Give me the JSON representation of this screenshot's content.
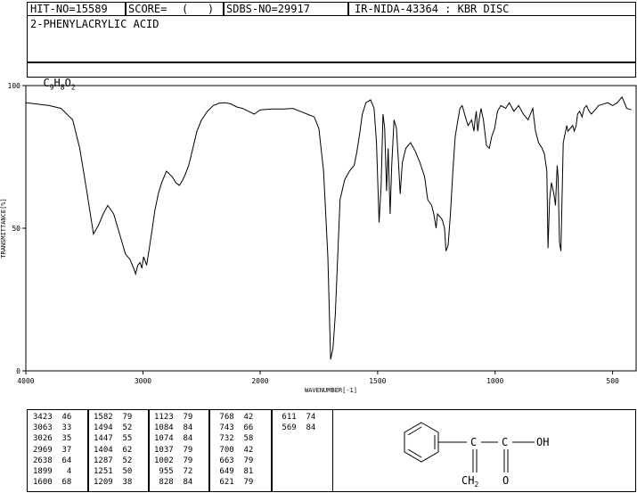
{
  "header": {
    "hit_no": "HIT-NO=15589",
    "score_label": "SCORE=",
    "score_value": "(   )",
    "sdbs_no": "SDBS-NO=29917",
    "ir_info": "IR-NIDA-43364 : KBR DISC"
  },
  "compound": {
    "name": "2-PHENYLACRYLIC ACID",
    "formula_c": "C",
    "formula_c_sub": "9",
    "formula_h": "H",
    "formula_h_sub": "8",
    "formula_o": "O",
    "formula_o_sub": "2"
  },
  "chart_data": {
    "type": "line",
    "xlabel": "WAVENUMBER[-1]",
    "ylabel": "TRANSMITTANCE[%]",
    "xlim": [
      4000,
      400
    ],
    "ylim": [
      0,
      100
    ],
    "x_ticks": [
      {
        "value": 4000,
        "label": "4000"
      },
      {
        "value": 3000,
        "label": "3000"
      },
      {
        "value": 2000,
        "label": "2000"
      },
      {
        "value": 1500,
        "label": "1500"
      },
      {
        "value": 1000,
        "label": "1000"
      },
      {
        "value": 500,
        "label": "500"
      }
    ],
    "y_ticks": [
      {
        "value": 100,
        "label": "100"
      },
      {
        "value": 50,
        "label": "50"
      },
      {
        "value": 0,
        "label": "0"
      }
    ],
    "x": [
      4000,
      3900,
      3800,
      3700,
      3600,
      3540,
      3480,
      3423,
      3380,
      3340,
      3300,
      3250,
      3200,
      3150,
      3110,
      3080,
      3063,
      3045,
      3026,
      3010,
      2995,
      2969,
      2950,
      2920,
      2900,
      2870,
      2840,
      2800,
      2750,
      2720,
      2690,
      2660,
      2638,
      2610,
      2580,
      2540,
      2500,
      2450,
      2400,
      2350,
      2300,
      2250,
      2200,
      2150,
      2100,
      2050,
      2000,
      1950,
      1899,
      1860,
      1830,
      1800,
      1770,
      1750,
      1730,
      1712,
      1700,
      1690,
      1680,
      1660,
      1640,
      1620,
      1600,
      1590,
      1582,
      1575,
      1565,
      1550,
      1530,
      1515,
      1505,
      1494,
      1485,
      1477,
      1470,
      1462,
      1455,
      1447,
      1440,
      1430,
      1420,
      1412,
      1404,
      1395,
      1380,
      1360,
      1340,
      1320,
      1300,
      1287,
      1270,
      1261,
      1255,
      1251,
      1245,
      1235,
      1225,
      1215,
      1209,
      1200,
      1190,
      1180,
      1170,
      1160,
      1150,
      1140,
      1130,
      1123,
      1115,
      1100,
      1090,
      1084,
      1080,
      1074,
      1068,
      1060,
      1050,
      1037,
      1025,
      1015,
      1002,
      990,
      975,
      955,
      940,
      920,
      900,
      880,
      860,
      840,
      828,
      815,
      800,
      790,
      780,
      775,
      768,
      760,
      750,
      743,
      736,
      732,
      726,
      720,
      710,
      700,
      695,
      690,
      680,
      670,
      663,
      655,
      649,
      640,
      630,
      621,
      611,
      600,
      590,
      580,
      569,
      560,
      540,
      520,
      500,
      480,
      460,
      440,
      420,
      400
    ],
    "y": [
      94,
      93.5,
      93,
      92,
      88,
      78,
      63,
      48,
      51,
      55,
      58,
      55,
      48,
      41,
      39,
      36,
      34,
      37,
      38,
      36,
      40,
      37,
      42,
      50,
      56,
      62,
      66,
      70,
      68,
      66,
      65,
      67,
      69,
      72,
      77,
      84,
      88,
      91,
      93,
      93.8,
      94,
      93.6,
      92.5,
      92,
      91,
      90,
      91.5,
      91.8,
      91.8,
      92,
      91,
      90,
      89,
      85,
      70,
      40,
      4,
      8,
      20,
      60,
      67,
      70,
      72,
      76,
      80,
      84,
      90,
      94,
      95,
      92,
      80,
      52,
      65,
      90,
      85,
      63,
      78,
      55,
      72,
      88,
      85,
      74,
      62,
      73,
      78,
      80,
      77,
      73,
      68,
      60,
      58,
      55,
      52,
      50,
      55,
      54,
      53,
      50,
      42,
      44,
      55,
      70,
      82,
      87,
      92,
      93,
      90,
      88,
      86,
      88,
      84,
      89,
      91,
      84,
      88,
      92,
      88,
      79,
      78,
      82,
      85,
      91,
      93,
      92,
      94,
      91,
      93,
      90,
      88,
      92,
      84,
      80,
      78,
      76,
      70,
      43,
      60,
      66,
      62,
      58,
      72,
      68,
      45,
      42,
      80,
      84,
      86,
      84,
      85,
      86,
      84,
      86,
      90,
      91,
      89,
      92,
      93,
      91,
      90,
      91,
      92,
      93,
      93.5,
      94,
      93,
      94,
      96,
      92,
      91.5
    ]
  },
  "peaks": {
    "col1": [
      "3423  46",
      "3063  33",
      "3026  35",
      "2969  37",
      "2638  64",
      "1899   4",
      "1600  68"
    ],
    "col2": [
      "1582  79",
      "1494  52",
      "1447  55",
      "1404  62",
      "1287  52",
      "1251  50",
      "1209  38"
    ],
    "col3": [
      "1123  79",
      "1084  84",
      "1074  84",
      "1037  79",
      "1002  79",
      " 955  72",
      " 828  84"
    ],
    "col4": [
      " 768  42",
      " 743  66",
      " 732  58",
      " 700  42",
      " 663  79",
      " 649  81",
      " 621  79"
    ],
    "col5": [
      " 611  74",
      " 569  84"
    ]
  },
  "structure": {
    "atom_oh": "OH",
    "atom_o": "O",
    "atom_ch": "CH",
    "atom_ch_sub": "2"
  }
}
